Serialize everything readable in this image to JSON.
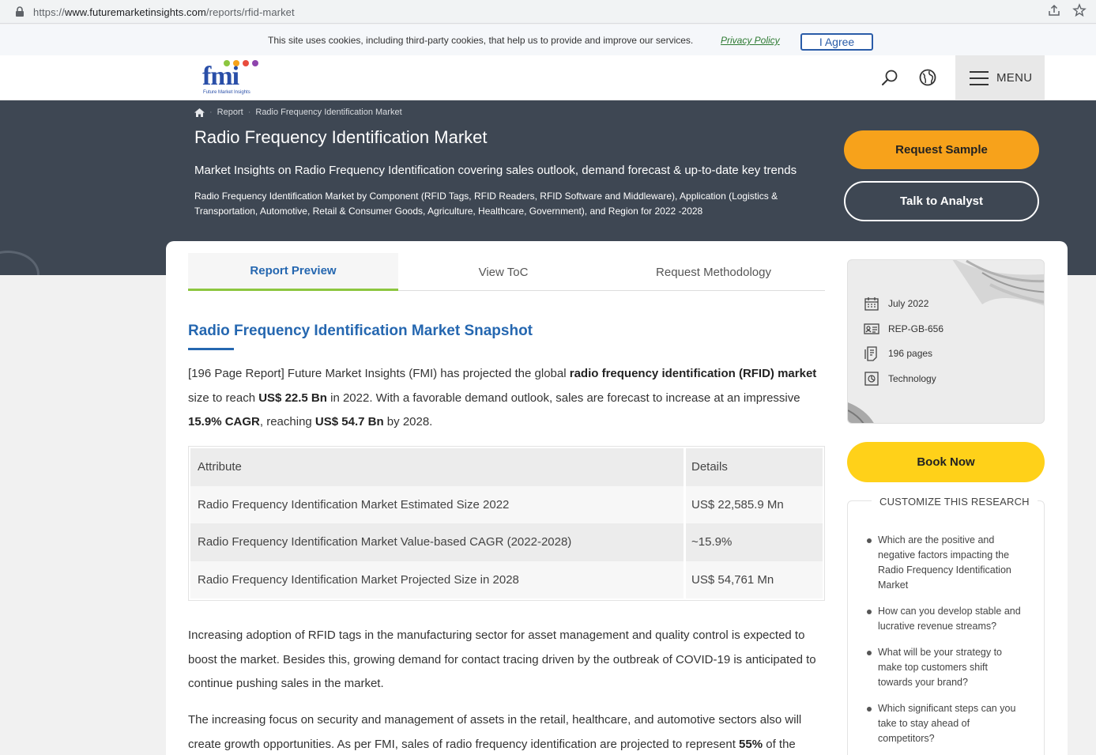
{
  "browser": {
    "url_scheme": "https://",
    "url_host": "www.futuremarketinsights.com",
    "url_path": "/reports/rfid-market"
  },
  "cookie": {
    "message": "This site uses cookies, including third-party cookies, that help us to provide and improve our services.",
    "privacy_link": "Privacy Policy",
    "agree_label": "I Agree"
  },
  "header": {
    "logo_text": "fmi",
    "logo_subtitle": "Future Market Insights",
    "menu_label": "MENU",
    "logo_dot_colors": [
      "#8cc63f",
      "#f7a21b",
      "#e84c3d",
      "#8e44ad"
    ]
  },
  "hero": {
    "breadcrumb": [
      "Report",
      "Radio Frequency Identification Market"
    ],
    "title": "Radio Frequency Identification Market",
    "tagline": "Market Insights on Radio Frequency Identification covering sales outlook, demand forecast & up-to-date key trends",
    "description": "Radio Frequency Identification Market by Component (RFID Tags, RFID Readers, RFID Software and Middleware), Application (Logistics & Transportation, Automotive, Retail & Consumer Goods, Agriculture, Healthcare, Government), and Region for 2022 -2028",
    "request_sample": "Request Sample",
    "talk_analyst": "Talk to Analyst"
  },
  "tabs": [
    "Report Preview",
    "View ToC",
    "Request Methodology"
  ],
  "main": {
    "snapshot_title": "Radio Frequency Identification Market Snapshot",
    "intro": {
      "p1": "[196 Page Report] Future Market Insights (FMI) has projected the global ",
      "b1": "radio frequency identification (RFID) market",
      "p2": " size to reach ",
      "b2": "US$ 22.5 Bn",
      "p3": " in 2022. With a favorable demand outlook, sales are forecast to increase at an impressive ",
      "b3": "15.9% CAGR",
      "p4": ", reaching ",
      "b4": "US$ 54.7 Bn",
      "p5": " by 2028."
    },
    "table": {
      "headers": [
        "Attribute",
        "Details"
      ],
      "rows": [
        [
          "Radio Frequency Identification Market Estimated Size 2022",
          "US$ 22,585.9 Mn"
        ],
        [
          "Radio Frequency Identification Market Value-based CAGR (2022-2028)",
          "~15.9%"
        ],
        [
          "Radio Frequency Identification Market Projected Size in 2028",
          "US$ 54,761 Mn"
        ]
      ]
    },
    "para2": "Increasing adoption of RFID tags in the manufacturing sector for asset management and quality control is expected to boost the market. Besides this, growing demand for contact tracing driven by the outbreak of COVID-19 is anticipated to continue pushing sales in the market.",
    "para3": {
      "p1": "The increasing focus on security and management of assets in the retail, healthcare, and automotive sectors also will create growth opportunities. As per FMI, sales of radio frequency identification are projected to represent ",
      "b1": "55%",
      "p2": " of the"
    }
  },
  "sidebar": {
    "info": [
      {
        "icon": "calendar-icon",
        "label": "July 2022"
      },
      {
        "icon": "id-card-icon",
        "label": "REP-GB-656"
      },
      {
        "icon": "pages-icon",
        "label": "196 pages"
      },
      {
        "icon": "category-icon",
        "label": "Technology"
      }
    ],
    "book_now": "Book Now",
    "customize_title": "CUSTOMIZE THIS RESEARCH",
    "questions": [
      "Which are the positive and negative factors impacting the Radio Frequency Identification Market",
      "How can you develop stable and lucrative revenue streams?",
      "What will be your strategy to make top customers shift towards your brand?",
      "Which significant steps can you take to stay ahead of competitors?"
    ]
  }
}
